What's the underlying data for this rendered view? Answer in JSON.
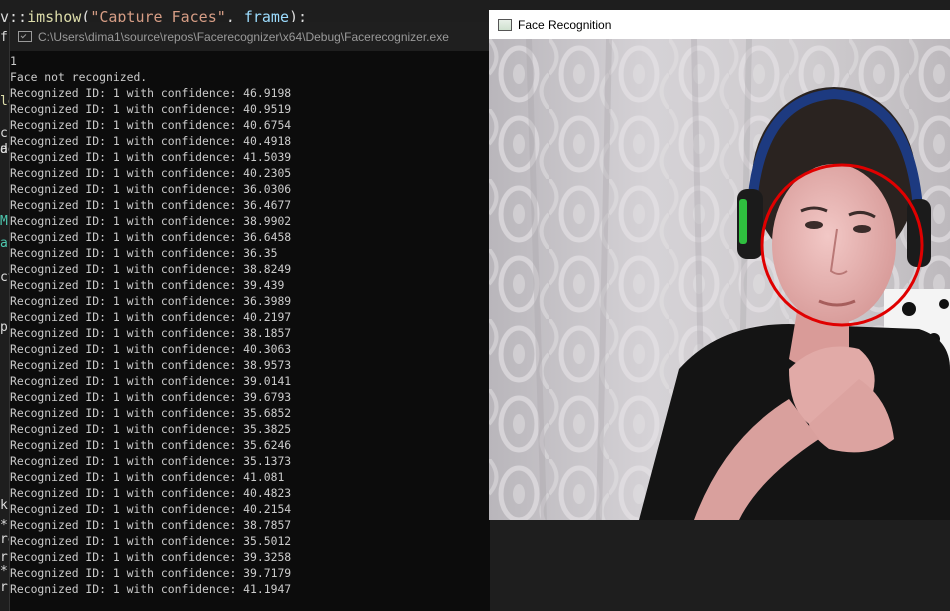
{
  "editor": {
    "code_line": {
      "prefix": "v::",
      "fn": "imshow",
      "open": "(",
      "str": "\"Capture Faces\"",
      "sep": ", ",
      "arg": "frame",
      "close": ");"
    },
    "gutter": [
      "f",
      "le",
      "d",
      "c",
      "ad",
      "M",
      "a",
      "cv",
      "p",
      "k",
      "*",
      "re",
      "r",
      "*",
      "r"
    ]
  },
  "console": {
    "title": "C:\\Users\\dima1\\source\\repos\\Facerecognizer\\x64\\Debug\\Facerecognizer.exe",
    "lines": [
      "1",
      "Face not recognized.",
      "Recognized ID: 1 with confidence: 46.9198",
      "Recognized ID: 1 with confidence: 40.9519",
      "Recognized ID: 1 with confidence: 40.6754",
      "Recognized ID: 1 with confidence: 40.4918",
      "Recognized ID: 1 with confidence: 41.5039",
      "Recognized ID: 1 with confidence: 40.2305",
      "Recognized ID: 1 with confidence: 36.0306",
      "Recognized ID: 1 with confidence: 36.4677",
      "Recognized ID: 1 with confidence: 38.9902",
      "Recognized ID: 1 with confidence: 36.6458",
      "Recognized ID: 1 with confidence: 36.35",
      "Recognized ID: 1 with confidence: 38.8249",
      "Recognized ID: 1 with confidence: 39.439",
      "Recognized ID: 1 with confidence: 36.3989",
      "Recognized ID: 1 with confidence: 40.2197",
      "Recognized ID: 1 with confidence: 38.1857",
      "Recognized ID: 1 with confidence: 40.3063",
      "Recognized ID: 1 with confidence: 38.9573",
      "Recognized ID: 1 with confidence: 39.0141",
      "Recognized ID: 1 with confidence: 39.6793",
      "Recognized ID: 1 with confidence: 35.6852",
      "Recognized ID: 1 with confidence: 35.3825",
      "Recognized ID: 1 with confidence: 35.6246",
      "Recognized ID: 1 with confidence: 35.1373",
      "Recognized ID: 1 with confidence: 41.081",
      "Recognized ID: 1 with confidence: 40.4823",
      "Recognized ID: 1 with confidence: 40.2154",
      "Recognized ID: 1 with confidence: 38.7857",
      "Recognized ID: 1 with confidence: 35.5012",
      "Recognized ID: 1 with confidence: 39.3258",
      "Recognized ID: 1 with confidence: 39.7179",
      "Recognized ID: 1 with confidence: 41.1947"
    ]
  },
  "face_window": {
    "title": "Face Recognition",
    "detection_color": "#e00000"
  },
  "icons": {
    "console": "console-app-icon",
    "face_window": "window-app-icon"
  }
}
